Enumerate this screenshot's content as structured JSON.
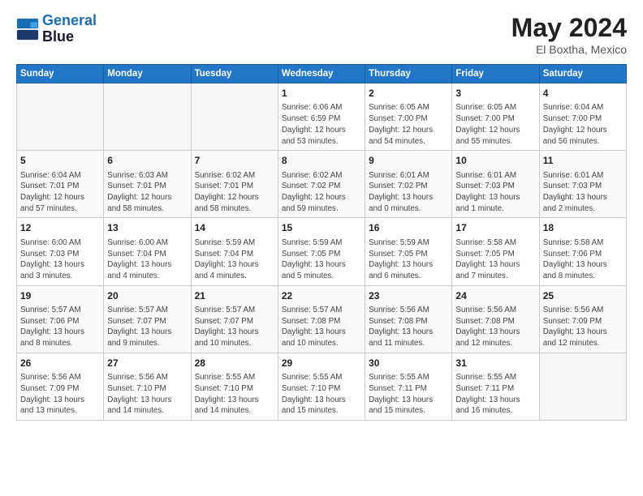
{
  "header": {
    "logo_line1": "General",
    "logo_line2": "Blue",
    "title": "May 2024",
    "subtitle": "El Boxtha, Mexico"
  },
  "weekdays": [
    "Sunday",
    "Monday",
    "Tuesday",
    "Wednesday",
    "Thursday",
    "Friday",
    "Saturday"
  ],
  "weeks": [
    [
      {
        "day": "",
        "info": ""
      },
      {
        "day": "",
        "info": ""
      },
      {
        "day": "",
        "info": ""
      },
      {
        "day": "1",
        "info": "Sunrise: 6:06 AM\nSunset: 6:59 PM\nDaylight: 12 hours\nand 53 minutes."
      },
      {
        "day": "2",
        "info": "Sunrise: 6:05 AM\nSunset: 7:00 PM\nDaylight: 12 hours\nand 54 minutes."
      },
      {
        "day": "3",
        "info": "Sunrise: 6:05 AM\nSunset: 7:00 PM\nDaylight: 12 hours\nand 55 minutes."
      },
      {
        "day": "4",
        "info": "Sunrise: 6:04 AM\nSunset: 7:00 PM\nDaylight: 12 hours\nand 56 minutes."
      }
    ],
    [
      {
        "day": "5",
        "info": "Sunrise: 6:04 AM\nSunset: 7:01 PM\nDaylight: 12 hours\nand 57 minutes."
      },
      {
        "day": "6",
        "info": "Sunrise: 6:03 AM\nSunset: 7:01 PM\nDaylight: 12 hours\nand 58 minutes."
      },
      {
        "day": "7",
        "info": "Sunrise: 6:02 AM\nSunset: 7:01 PM\nDaylight: 12 hours\nand 58 minutes."
      },
      {
        "day": "8",
        "info": "Sunrise: 6:02 AM\nSunset: 7:02 PM\nDaylight: 12 hours\nand 59 minutes."
      },
      {
        "day": "9",
        "info": "Sunrise: 6:01 AM\nSunset: 7:02 PM\nDaylight: 13 hours\nand 0 minutes."
      },
      {
        "day": "10",
        "info": "Sunrise: 6:01 AM\nSunset: 7:03 PM\nDaylight: 13 hours\nand 1 minute."
      },
      {
        "day": "11",
        "info": "Sunrise: 6:01 AM\nSunset: 7:03 PM\nDaylight: 13 hours\nand 2 minutes."
      }
    ],
    [
      {
        "day": "12",
        "info": "Sunrise: 6:00 AM\nSunset: 7:03 PM\nDaylight: 13 hours\nand 3 minutes."
      },
      {
        "day": "13",
        "info": "Sunrise: 6:00 AM\nSunset: 7:04 PM\nDaylight: 13 hours\nand 4 minutes."
      },
      {
        "day": "14",
        "info": "Sunrise: 5:59 AM\nSunset: 7:04 PM\nDaylight: 13 hours\nand 4 minutes."
      },
      {
        "day": "15",
        "info": "Sunrise: 5:59 AM\nSunset: 7:05 PM\nDaylight: 13 hours\nand 5 minutes."
      },
      {
        "day": "16",
        "info": "Sunrise: 5:59 AM\nSunset: 7:05 PM\nDaylight: 13 hours\nand 6 minutes."
      },
      {
        "day": "17",
        "info": "Sunrise: 5:58 AM\nSunset: 7:05 PM\nDaylight: 13 hours\nand 7 minutes."
      },
      {
        "day": "18",
        "info": "Sunrise: 5:58 AM\nSunset: 7:06 PM\nDaylight: 13 hours\nand 8 minutes."
      }
    ],
    [
      {
        "day": "19",
        "info": "Sunrise: 5:57 AM\nSunset: 7:06 PM\nDaylight: 13 hours\nand 8 minutes."
      },
      {
        "day": "20",
        "info": "Sunrise: 5:57 AM\nSunset: 7:07 PM\nDaylight: 13 hours\nand 9 minutes."
      },
      {
        "day": "21",
        "info": "Sunrise: 5:57 AM\nSunset: 7:07 PM\nDaylight: 13 hours\nand 10 minutes."
      },
      {
        "day": "22",
        "info": "Sunrise: 5:57 AM\nSunset: 7:08 PM\nDaylight: 13 hours\nand 10 minutes."
      },
      {
        "day": "23",
        "info": "Sunrise: 5:56 AM\nSunset: 7:08 PM\nDaylight: 13 hours\nand 11 minutes."
      },
      {
        "day": "24",
        "info": "Sunrise: 5:56 AM\nSunset: 7:08 PM\nDaylight: 13 hours\nand 12 minutes."
      },
      {
        "day": "25",
        "info": "Sunrise: 5:56 AM\nSunset: 7:09 PM\nDaylight: 13 hours\nand 12 minutes."
      }
    ],
    [
      {
        "day": "26",
        "info": "Sunrise: 5:56 AM\nSunset: 7:09 PM\nDaylight: 13 hours\nand 13 minutes."
      },
      {
        "day": "27",
        "info": "Sunrise: 5:56 AM\nSunset: 7:10 PM\nDaylight: 13 hours\nand 14 minutes."
      },
      {
        "day": "28",
        "info": "Sunrise: 5:55 AM\nSunset: 7:10 PM\nDaylight: 13 hours\nand 14 minutes."
      },
      {
        "day": "29",
        "info": "Sunrise: 5:55 AM\nSunset: 7:10 PM\nDaylight: 13 hours\nand 15 minutes."
      },
      {
        "day": "30",
        "info": "Sunrise: 5:55 AM\nSunset: 7:11 PM\nDaylight: 13 hours\nand 15 minutes."
      },
      {
        "day": "31",
        "info": "Sunrise: 5:55 AM\nSunset: 7:11 PM\nDaylight: 13 hours\nand 16 minutes."
      },
      {
        "day": "",
        "info": ""
      }
    ]
  ]
}
